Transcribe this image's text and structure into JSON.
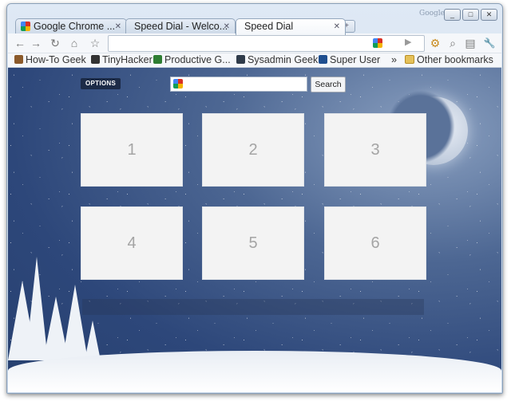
{
  "window": {
    "brand_text": "Google",
    "controls": {
      "minimize": "_",
      "maximize": "□",
      "close": "✕"
    }
  },
  "tabs": [
    {
      "title": "Google Chrome ...",
      "close": "✕",
      "active": false,
      "icon": "google-favicon"
    },
    {
      "title": "Speed Dial - Welco...",
      "close": "✕",
      "active": false,
      "icon": null
    },
    {
      "title": "Speed Dial",
      "close": "✕",
      "active": true,
      "icon": null
    }
  ],
  "toolbar": {
    "back": "←",
    "forward": "→",
    "reload": "↻",
    "home": "⌂",
    "star": "☆",
    "page_menu": "▤",
    "tools_menu": "🔧",
    "omnibox_value": ""
  },
  "bookmarks": [
    {
      "label": "How-To Geek",
      "icon": "howtogeek-icon",
      "color": "#8b5a2b"
    },
    {
      "label": "TinyHacker",
      "icon": "tinyhacker-icon",
      "color": "#333333"
    },
    {
      "label": "Productive G...",
      "icon": "pg-icon",
      "color": "#2e7d32"
    },
    {
      "label": "Sysadmin Geek",
      "icon": "sg-icon",
      "color": "#2f3b4a"
    },
    {
      "label": "Super User",
      "icon": "superuser-icon",
      "color": "#1f4f8f"
    }
  ],
  "bookmarks_overflow": "»",
  "other_bookmarks": "Other bookmarks",
  "speed_dial": {
    "options_label": "OPTIONS",
    "search_placeholder": "",
    "search_button": "Search",
    "dials": [
      "1",
      "2",
      "3",
      "4",
      "5",
      "6"
    ]
  },
  "colors": {
    "background_sky": "#2d477a",
    "dial_fill": "#f3f3f3",
    "dial_number": "#a4a4a4",
    "options_bg": "#1c2b47"
  }
}
